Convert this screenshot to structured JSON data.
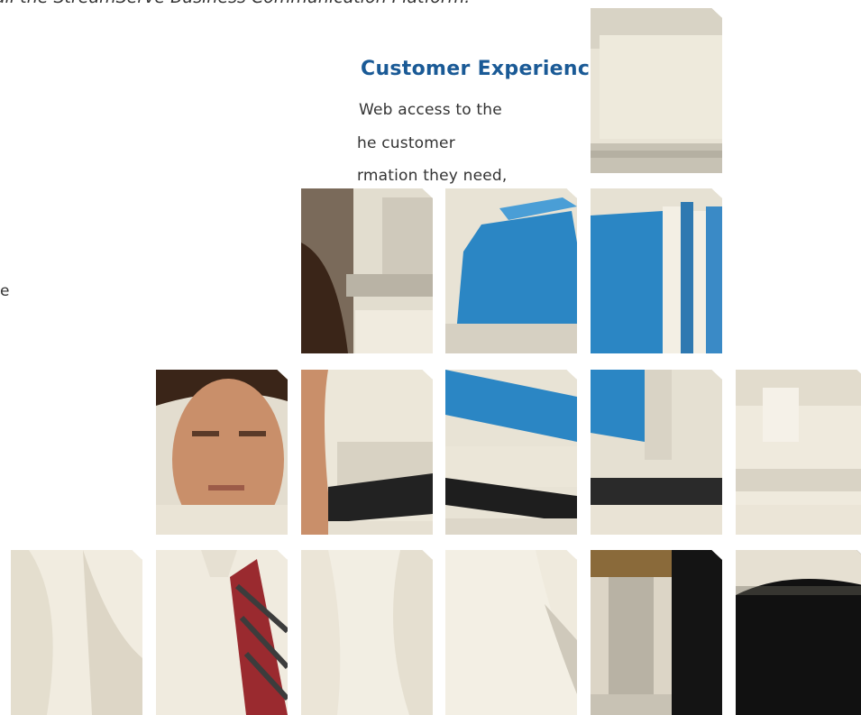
{
  "document": {
    "intro_line": "all the StreamServe Business Communication Platform.",
    "heading": "Customer Experience",
    "heading_color": "#1a5a96",
    "body_lines": [
      "Web access to the",
      "he customer",
      "rmation they need,",
      "e"
    ]
  },
  "photo_mosaic": {
    "description_icon": "photo-tiles",
    "tile_count": 15,
    "palette": {
      "background": "#ece6d6",
      "folder_blue": "#2b86c4",
      "shirt": "#f0ebdf",
      "skin": "#c98f6a",
      "hair": "#3a2518",
      "tie_red": "#9a2a2f",
      "shadow": "#1a1a1a"
    }
  }
}
